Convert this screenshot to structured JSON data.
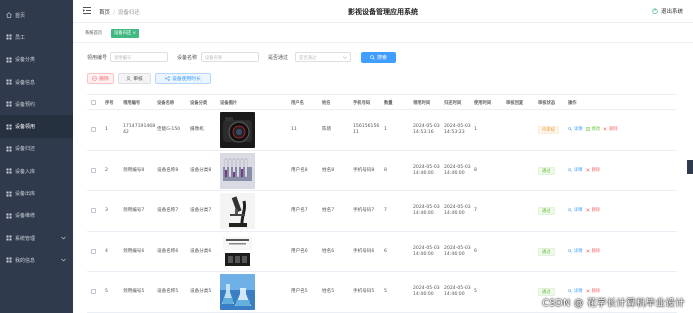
{
  "sidebar": {
    "items": [
      {
        "label": "首页",
        "icon": "home-icon"
      },
      {
        "label": "员工",
        "icon": "grid-icon"
      },
      {
        "label": "设备分类",
        "icon": "grid-icon"
      },
      {
        "label": "设备信息",
        "icon": "grid-icon"
      },
      {
        "label": "设备预约",
        "icon": "grid-icon"
      },
      {
        "label": "设备领用",
        "icon": "grid-icon"
      },
      {
        "label": "设备归还",
        "icon": "grid-icon"
      },
      {
        "label": "设备入库",
        "icon": "grid-icon"
      },
      {
        "label": "设备出库",
        "icon": "grid-icon"
      },
      {
        "label": "设备维修",
        "icon": "grid-icon"
      },
      {
        "label": "系统管理",
        "icon": "grid-icon"
      },
      {
        "label": "我的信息",
        "icon": "grid-icon"
      }
    ]
  },
  "header": {
    "breadcrumb_home": "首页",
    "breadcrumb_sep": "/",
    "breadcrumb_current": "设备归还",
    "app_title": "影视设备管理应用系统",
    "logout": "退出系统"
  },
  "tabs": {
    "home": "系统首页",
    "active": "设备归还 ×"
  },
  "search": {
    "field1_label": "领用编号",
    "field1_placeholder": "领用编号",
    "field2_label": "设备名称",
    "field2_placeholder": "设备名称",
    "field3_label": "是否通过",
    "field3_placeholder": "是否通过",
    "button": "搜索"
  },
  "actions": {
    "delete": "删除",
    "audit": "审核",
    "usage": "设备使用时长"
  },
  "table": {
    "headers": [
      "序号",
      "领用编号",
      "设备名称",
      "设备分类",
      "设备图片",
      "用户名",
      "姓名",
      "手机号码",
      "数量",
      "领用时间",
      "归还时间",
      "使用时间",
      "审核回复",
      "审核状态",
      "操作"
    ],
    "ops": {
      "detail": "详情",
      "edit": "修改",
      "remove": "删除"
    },
    "rows": [
      {
        "idx": "1",
        "code": "1714719146842",
        "name": "佳能G-150",
        "category": "摄像机",
        "user": "11",
        "person": "陈晓",
        "phone": "15615615611",
        "qty": "1",
        "borrow": "2024-05-03 14:53:16",
        "ret": "2024-05-03 14:53:23",
        "used": "1",
        "reply": "",
        "status": "待审核",
        "status_type": "pending",
        "has_edit": true
      },
      {
        "idx": "2",
        "code": "领用编号8",
        "name": "设备名称8",
        "category": "设备分类8",
        "user": "用户名8",
        "person": "姓名8",
        "phone": "手机号码8",
        "qty": "8",
        "borrow": "2024-05-03 14:46:00",
        "ret": "2024-05-03 14:46:00",
        "used": "8",
        "reply": "",
        "status": "通过",
        "status_type": "ok",
        "has_edit": false
      },
      {
        "idx": "3",
        "code": "领用编号7",
        "name": "设备名称7",
        "category": "设备分类7",
        "user": "用户名7",
        "person": "姓名7",
        "phone": "手机号码7",
        "qty": "7",
        "borrow": "2024-05-03 14:46:00",
        "ret": "2024-05-03 14:46:00",
        "used": "7",
        "reply": "",
        "status": "通过",
        "status_type": "ok",
        "has_edit": false
      },
      {
        "idx": "4",
        "code": "领用编号6",
        "name": "设备名称6",
        "category": "设备分类6",
        "user": "用户名6",
        "person": "姓名6",
        "phone": "手机号码6",
        "qty": "6",
        "borrow": "2024-05-03 14:46:00",
        "ret": "2024-05-03 14:46:00",
        "used": "6",
        "reply": "",
        "status": "通过",
        "status_type": "ok",
        "has_edit": false
      },
      {
        "idx": "5",
        "code": "领用编号5",
        "name": "设备名称5",
        "category": "设备分类5",
        "user": "用户名5",
        "person": "姓名5",
        "phone": "手机号码5",
        "qty": "5",
        "borrow": "2024-05-03 14:46:00",
        "ret": "2024-05-03 14:46:00",
        "used": "5",
        "reply": "",
        "status": "通过",
        "status_type": "ok",
        "has_edit": false
      }
    ]
  },
  "images": [
    "camera-photo",
    "test-tube-rack-photo",
    "microscope-photo",
    "book-kit-photo",
    "lab-glassware-photo"
  ],
  "watermark": "CSDN @ 花学长计算机毕业设计",
  "colors": {
    "sidebar_bg": "#2f3b4c",
    "primary": "#409eff",
    "success": "#42b983",
    "danger": "#f56c6c",
    "warning": "#e6a23c"
  }
}
